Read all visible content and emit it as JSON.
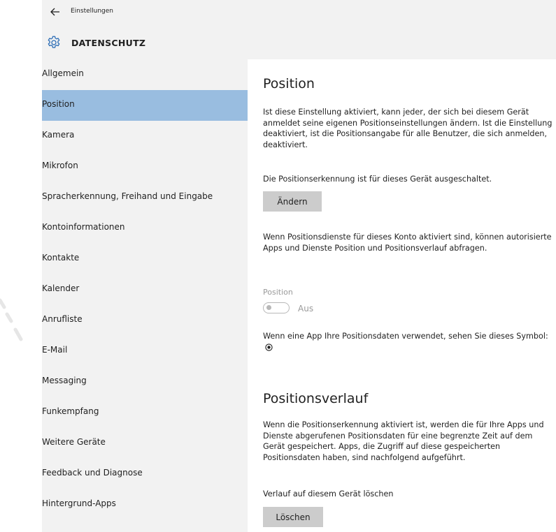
{
  "titlebar": {
    "label": "Einstellungen",
    "back_icon": "back-arrow-icon"
  },
  "header": {
    "title": "DATENSCHUTZ",
    "icon": "gear-icon"
  },
  "sidebar": {
    "selected_index": 1,
    "items": [
      {
        "label": "Allgemein"
      },
      {
        "label": "Position"
      },
      {
        "label": "Kamera"
      },
      {
        "label": "Mikrofon"
      },
      {
        "label": "Spracherkennung, Freihand und Eingabe"
      },
      {
        "label": "Kontoinformationen"
      },
      {
        "label": "Kontakte"
      },
      {
        "label": "Kalender"
      },
      {
        "label": "Anrufliste"
      },
      {
        "label": "E-Mail"
      },
      {
        "label": "Messaging"
      },
      {
        "label": "Funkempfang"
      },
      {
        "label": "Weitere Geräte"
      },
      {
        "label": "Feedback und Diagnose"
      },
      {
        "label": "Hintergrund-Apps"
      }
    ]
  },
  "content": {
    "position_heading": "Position",
    "intro": "Ist diese Einstellung aktiviert, kann jeder, der sich bei diesem Gerät anmeldet seine eigenen Positionseinstellungen ändern. Ist die Einstellung deaktiviert, ist die Positionsangabe für alle Benutzer, die sich anmelden, deaktiviert.",
    "device_status": "Die Positionserkennung ist für dieses Gerät ausgeschaltet.",
    "change_button": "Ändern",
    "account_info": "Wenn Positionsdienste für dieses Konto aktiviert sind, können autorisierte Apps und Dienste Position und Positionsverlauf abfragen.",
    "toggle_label": "Position",
    "toggle_state": "Aus",
    "toggle_on": false,
    "symbol_text": "Wenn eine App Ihre Positionsdaten verwendet, sehen Sie dieses Symbol:",
    "history_heading": "Positionsverlauf",
    "history_text": "Wenn die Positionserkennung aktiviert ist, werden die für Ihre Apps und Dienste abgerufenen Positionsdaten für eine begrenzte Zeit auf dem Gerät gespeichert. Apps, die Zugriff auf diese gespeicherten Positionsdaten haben, sind nachfolgend aufgeführt.",
    "clear_history_label": "Verlauf auf diesem Gerät löschen",
    "clear_button": "Löschen"
  },
  "colors": {
    "sidebar_bg": "#f2f2f2",
    "selected_bg": "#99bde0",
    "button_bg": "#cccccc",
    "disabled_text": "#9a9a9a"
  }
}
